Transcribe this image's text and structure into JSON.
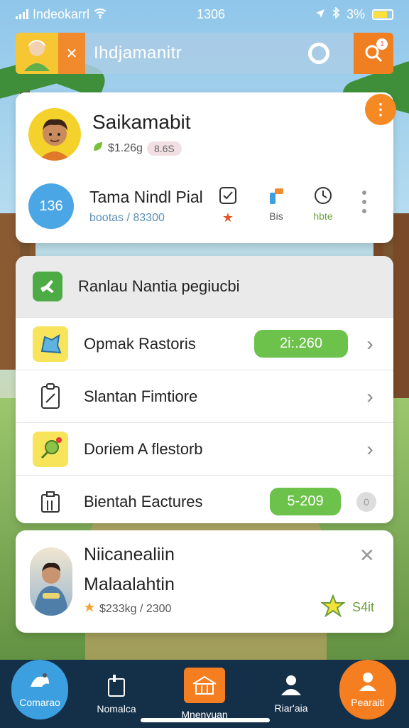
{
  "status_bar": {
    "carrier": "Indeokarrl",
    "time": "1306",
    "battery": "3%"
  },
  "app_bar": {
    "title": "Ihdjamanitr",
    "notification_count": "1"
  },
  "profile": {
    "name": "Saikamabit",
    "amount": "$1.26g",
    "pill": "8.6S",
    "badge": "136",
    "sub_title": "Tama Nindl Pial",
    "sub_meta": "bootas / 83300",
    "stats": [
      {
        "icon": "checklist-icon",
        "label": "★"
      },
      {
        "icon": "hammer-icon",
        "label": "Bis"
      },
      {
        "icon": "timer-icon",
        "label": "hbte"
      }
    ]
  },
  "list": {
    "header": "Ranlau Nantia pegiucbi",
    "rows": [
      {
        "label": "Opmak Rastoris",
        "value": "2i:.260",
        "icon": "star-shape-icon",
        "icon_bg": "#f7e45a"
      },
      {
        "label": "Slantan Fimtiore",
        "value": "",
        "icon": "clipboard-icon",
        "icon_bg": "#ffffff"
      },
      {
        "label": "Doriem A flestorb",
        "value": "",
        "icon": "pin-icon",
        "icon_bg": "#f7e45a"
      },
      {
        "label": "Bientah Eactures",
        "value": "5-209",
        "icon": "building-icon",
        "icon_bg": "#ffffff"
      }
    ]
  },
  "notice": {
    "title": "Niicanealiin",
    "subtitle": "Malaalahtin",
    "meta": "$233kg / 2300",
    "score": "S4it"
  },
  "nav": {
    "home": "Comarao",
    "item2": "Nomalca",
    "item3": "Mnenyuan",
    "item4": "Riar'aia",
    "profile": "Pearaiti"
  },
  "colors": {
    "accent_orange": "#f47e20",
    "accent_blue": "#4ba6e6",
    "accent_green": "#6cc24a",
    "nav_bg": "#133048"
  }
}
